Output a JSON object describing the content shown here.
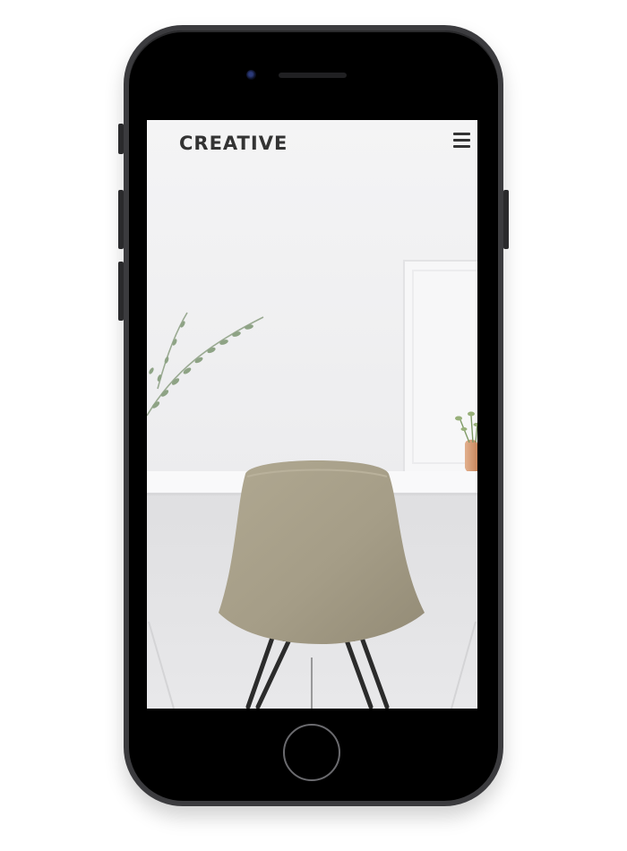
{
  "app": {
    "brand": "CREATIVE",
    "menu_icon": "hamburger-menu-icon"
  },
  "hero": {
    "subject": "chair-at-desk-photo"
  },
  "colors": {
    "phone_frame": "#3b3b3e",
    "brand_text": "#333333",
    "wall": "#f3f3f4",
    "chair": "#a59d87"
  }
}
